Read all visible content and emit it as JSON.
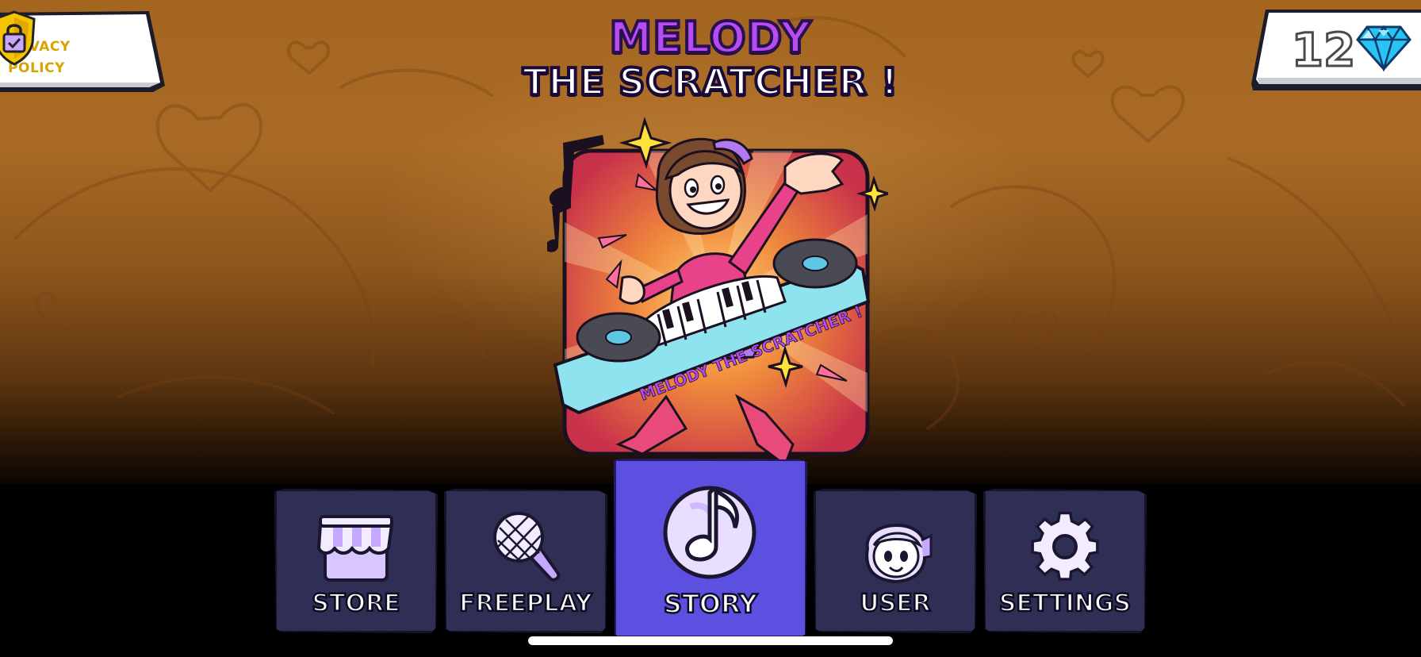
{
  "privacy": {
    "label_line1": "PRIVACY",
    "label_line2": "POLICY",
    "icon": "lock-shield-icon"
  },
  "gems": {
    "count": "12",
    "icon": "diamond-icon"
  },
  "title": {
    "line1": "MELODY",
    "line2": "THE SCRATCHER !"
  },
  "hero": {
    "banner_text": "MELODY THE SCRATCHER !"
  },
  "nav": {
    "items": [
      {
        "label": "STORE",
        "icon": "storefront-icon"
      },
      {
        "label": "FREEPLAY",
        "icon": "microphone-icon"
      },
      {
        "label": "STORY",
        "icon": "music-note-icon",
        "active": true
      },
      {
        "label": "USER",
        "icon": "user-avatar-icon"
      },
      {
        "label": "SETTINGS",
        "icon": "gear-icon"
      }
    ]
  },
  "colors": {
    "title_purple": "#b44cf0",
    "nav_tile": "#2f2e54",
    "nav_active": "#5d4fe0",
    "privacy_text": "#d8a400",
    "gem": "#29c4f6"
  }
}
